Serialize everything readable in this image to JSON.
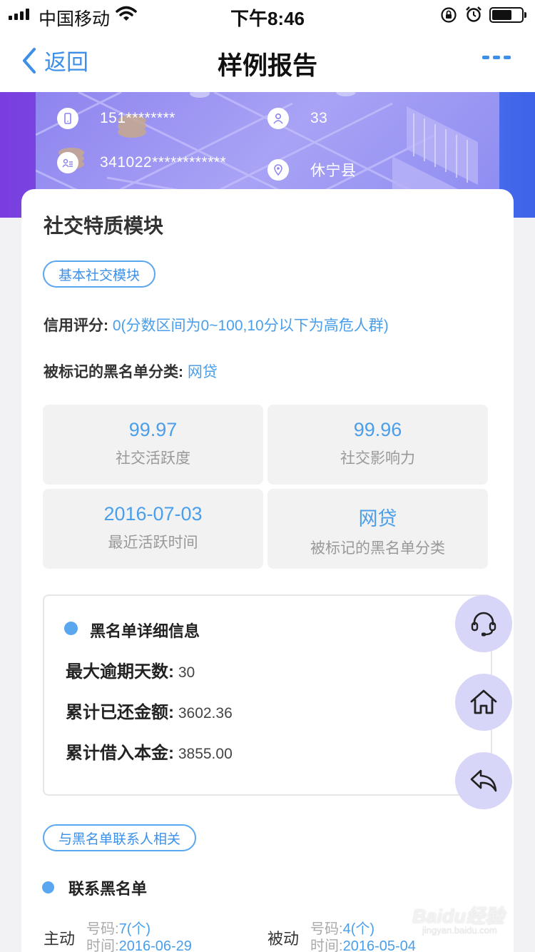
{
  "status_bar": {
    "carrier": "中国移动",
    "time": "下午8:46"
  },
  "nav": {
    "back_label": "返回",
    "title": "样例报告"
  },
  "banner": {
    "phone": "151********",
    "age": "33",
    "id_number": "341022************",
    "location": "休宁县"
  },
  "module": {
    "title": "社交特质模块",
    "tag_basic": "基本社交模块",
    "credit_key": "信用评分:",
    "credit_value": "0(分数区间为0~100,10分以下为高危人群)",
    "blacklist_key": "被标记的黑名单分类:",
    "blacklist_value": "网贷",
    "stats": [
      {
        "value": "99.97",
        "label": "社交活跃度"
      },
      {
        "value": "99.96",
        "label": "社交影响力"
      },
      {
        "value": "2016-07-03",
        "label": "最近活跃时间"
      },
      {
        "value": "网贷",
        "label": "被标记的黑名单分类"
      }
    ],
    "detail": {
      "title": "黑名单详细信息",
      "rows": [
        {
          "key": "最大逾期天数:",
          "value": "30"
        },
        {
          "key": "累计已还金额:",
          "value": "3602.36"
        },
        {
          "key": "累计借入本金:",
          "value": "3855.00"
        }
      ]
    },
    "tag_contacts": "与黑名单联系人相关",
    "contacts_title": "联系黑名单",
    "contacts": {
      "active": {
        "label": "主动",
        "number_key": "号码:",
        "number_value": "7(个)",
        "time_key": "时间:",
        "time_value": "2016-06-29"
      },
      "passive": {
        "label": "被动",
        "number_key": "号码:",
        "number_value": "4(个)",
        "time_key": "时间:",
        "time_value": "2016-05-04"
      }
    }
  },
  "watermark": {
    "main": "Baidu经验",
    "sub": "jingyan.baidu.com"
  },
  "colors": {
    "accent": "#3d8fe8",
    "value_blue": "#4a9eea",
    "banner_purple": "#7a3ee0",
    "float_bg": "#d8d6f8"
  }
}
